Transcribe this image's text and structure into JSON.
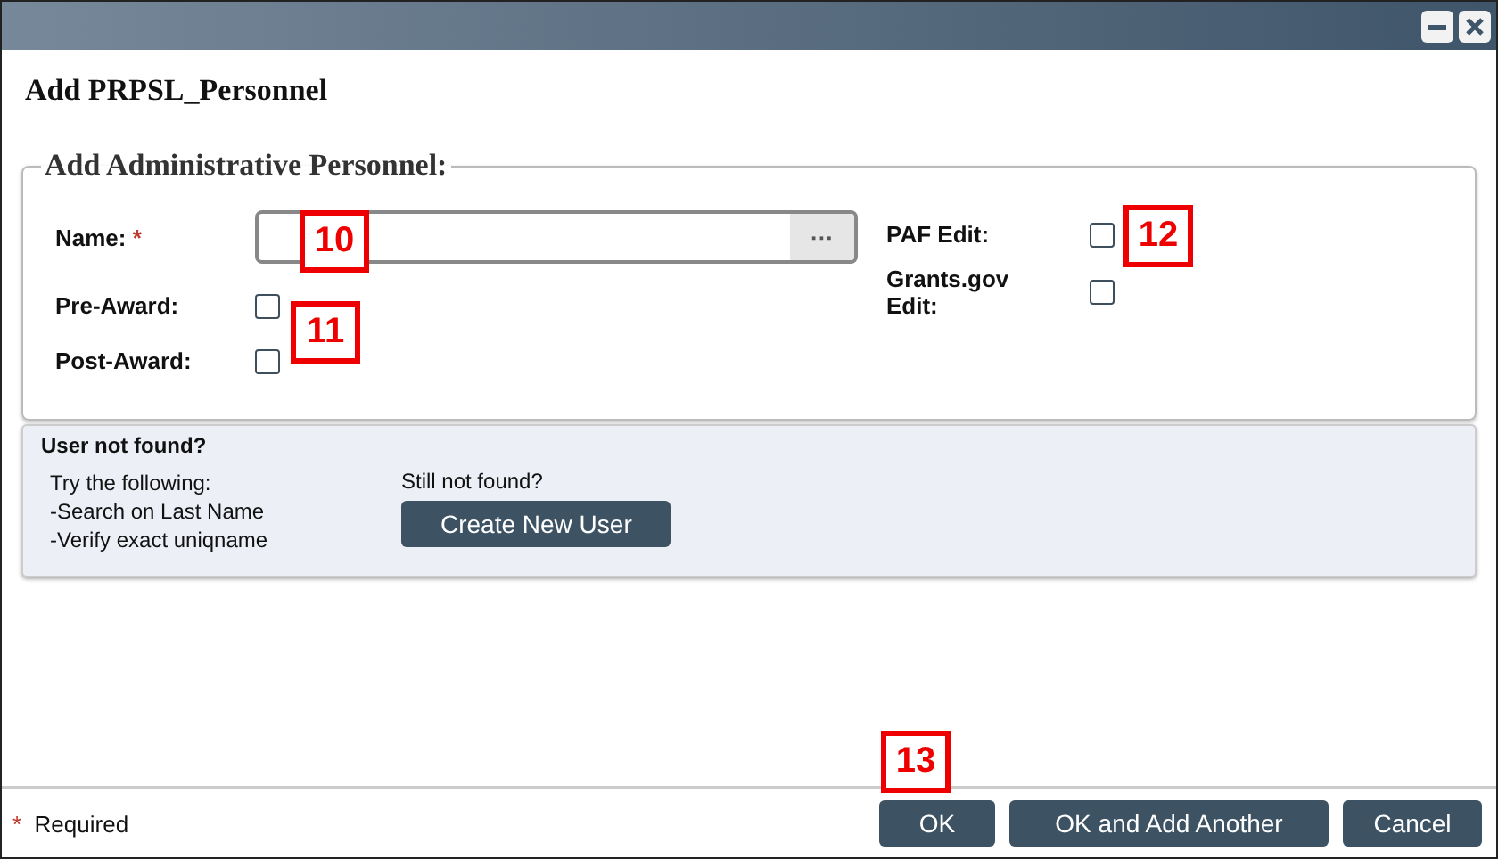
{
  "window": {
    "title": "Add PRPSL_Personnel"
  },
  "section": {
    "legend": "Add Administrative Personnel:",
    "name_field": {
      "label": "Name:",
      "required_mark": "*",
      "lookup_button": "···"
    },
    "left_checks": [
      {
        "label": "Pre-Award:",
        "checked": false
      },
      {
        "label": "Post-Award:",
        "checked": false
      }
    ],
    "right_checks": [
      {
        "label": "PAF Edit:",
        "checked": false
      },
      {
        "label": "Grants.gov Edit:",
        "checked": false
      }
    ]
  },
  "help": {
    "heading": "User not found?",
    "lines": [
      "Try the following:",
      "-Search on Last Name",
      "-Verify exact uniqname"
    ],
    "still": "Still not found?",
    "button": "Create New User"
  },
  "footer": {
    "required_mark": "*",
    "required_label": "Required",
    "buttons": [
      "OK",
      "OK and Add Another",
      "Cancel"
    ]
  },
  "callouts": [
    {
      "label": "10"
    },
    {
      "label": "11"
    },
    {
      "label": "12"
    },
    {
      "label": "13"
    }
  ]
}
